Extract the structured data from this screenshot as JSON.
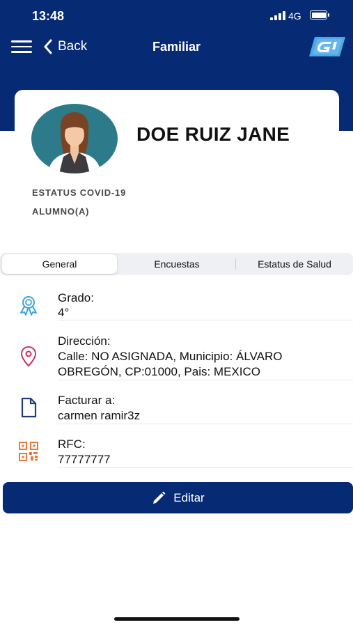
{
  "status_bar": {
    "time": "13:48",
    "network": "4G"
  },
  "nav": {
    "back_label": "Back",
    "title": "Familiar"
  },
  "profile": {
    "name": "DOE RUIZ JANE",
    "covid_status_label": "ESTATUS COVID-19",
    "role": "ALUMNO(A)"
  },
  "tabs": [
    {
      "label": "General",
      "active": true
    },
    {
      "label": "Encuestas",
      "active": false
    },
    {
      "label": "Estatus de Salud",
      "active": false
    }
  ],
  "info": {
    "grado": {
      "label": "Grado:",
      "value": "4°",
      "icon": "award-icon"
    },
    "direccion": {
      "label": "Dirección:",
      "value_line1": "Calle: NO ASIGNADA, Municipio: ÁLVARO",
      "value_line2": "OBREGÓN, CP:01000, Pais: MEXICO",
      "icon": "location-pin-icon"
    },
    "facturar": {
      "label": "Facturar a:",
      "value": "carmen ramir3z",
      "icon": "document-icon"
    },
    "rfc": {
      "label": "RFC:",
      "value": "77777777",
      "icon": "qr-code-icon"
    }
  },
  "actions": {
    "edit_label": "Editar"
  },
  "colors": {
    "primary": "#062a73",
    "award_icon": "#3fa3e0",
    "pin_icon": "#c8325a",
    "doc_icon": "#1e3a7a",
    "qr_icon": "#e8793c"
  }
}
